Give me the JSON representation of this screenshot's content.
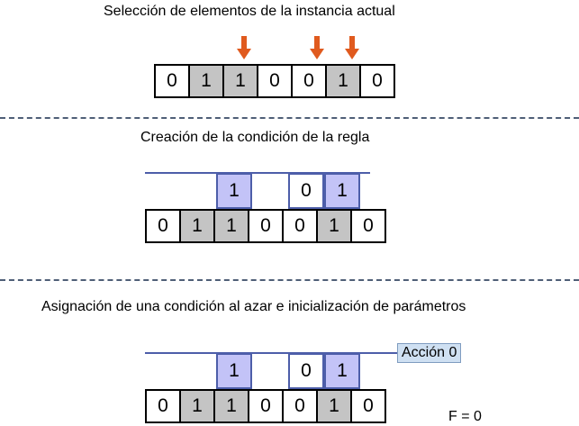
{
  "headings": {
    "selection": "Selección de elementos de la instancia actual",
    "creation": "Creación de la condición de la regla",
    "assignment": "Asignación de una condición al azar e inicialización de parámetros"
  },
  "instance": {
    "values": [
      "0",
      "1",
      "1",
      "0",
      "0",
      "1",
      "0"
    ],
    "shaded": [
      false,
      true,
      true,
      false,
      false,
      true,
      false
    ]
  },
  "selected_indices": [
    2,
    4,
    5
  ],
  "condition": {
    "values": [
      "",
      "",
      "1",
      "",
      "0",
      "1",
      ""
    ]
  },
  "action_label": "Acción 0",
  "fitness_label": "F = 0",
  "colors": {
    "arrow": "#e05a1e",
    "shaded_cell": "#c4c4c4",
    "condition_fill": "#c3c3f7",
    "condition_border": "#4d5ea9",
    "action_box": "#cfe0f2",
    "divider": "#4f5f77"
  }
}
